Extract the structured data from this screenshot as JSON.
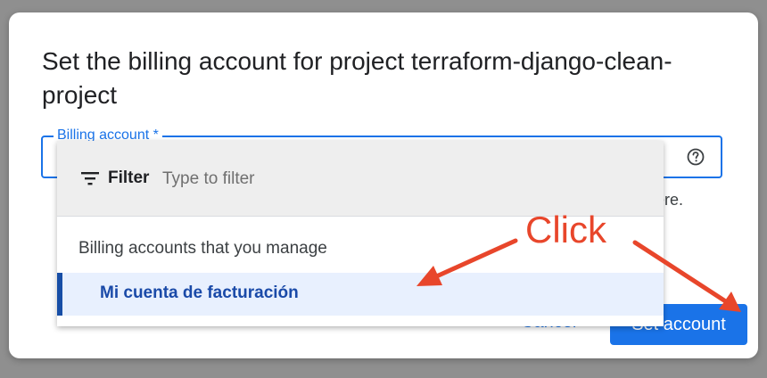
{
  "dialog": {
    "title": "Set the billing account for project terraform-django-clean-project"
  },
  "field": {
    "label": "Billing account *",
    "helper_tail": "ere."
  },
  "dropdown": {
    "filter_label": "Filter",
    "filter_placeholder": "Type to filter",
    "group_header": "Billing accounts that you manage",
    "options": [
      {
        "label": "Mi cuenta de facturación"
      }
    ]
  },
  "buttons": {
    "cancel": "Cancel",
    "set_account": "Set account"
  },
  "annotation": {
    "text": "Click",
    "color": "#e8462b"
  },
  "colors": {
    "primary": "#1a73e8",
    "selected_bg": "#e8f0fe"
  }
}
